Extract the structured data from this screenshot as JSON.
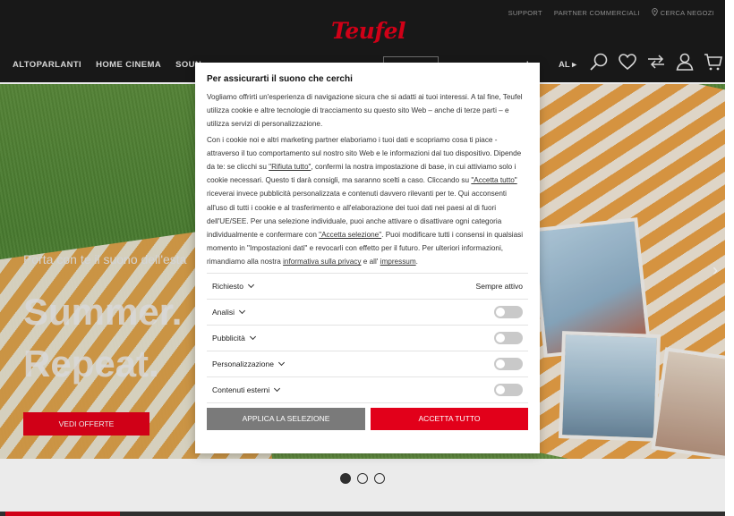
{
  "header": {
    "toplinks": [
      "SUPPORT",
      "PARTNER COMMERCIALI",
      "CERCA NEGOZI"
    ],
    "logo": "Teufel",
    "nav": [
      "ALTOPARLANTI",
      "HOME CINEMA",
      "SOUN"
    ],
    "nav_right_fragment": "I",
    "nav_al": "AL ▸"
  },
  "hero": {
    "subtitle": "Porta con te il suono dell'esta",
    "title_line1": "Summer.",
    "title_line2": "Repeat.",
    "cta": "VEDI OFFERTE",
    "next_arrow": "›"
  },
  "modal": {
    "title": "Per assicurarti il suono che cerchi",
    "p1": "Vogliamo offrirti un'esperienza di navigazione sicura che si adatti ai tuoi interessi. A tal fine, Teufel utilizza cookie e altre tecnologie di tracciamento su questo sito Web – anche di terze parti – e utilizza servizi di personalizzazione.",
    "p2_a": "Con i cookie noi e altri marketing partner elaboriamo i tuoi dati e scopriamo cosa ti piace - attraverso il tuo comportamento sul nostro sito Web e le informazioni dal tuo dispositivo. Dipende da te: se clicchi su ",
    "p2_link1": "\"Rifiuta tutto\"",
    "p2_b": ", confermi la nostra impostazione di base, in cui attiviamo solo i cookie necessari. Questo ti darà consigli, ma saranno scelti a caso. Cliccando su ",
    "p2_link2": "\"Accetta tutto\"",
    "p2_c": " riceverai invece pubblicità personalizzata e contenuti davvero rilevanti per te. Qui acconsenti all'uso di tutti i cookie e al trasferimento e all'elaborazione dei tuoi dati nei paesi al di fuori dell'UE/SEE. Per una selezione individuale, puoi anche attivare o disattivare ogni categoria individualmente e confermare con ",
    "p2_link3": "\"Accetta selezione\"",
    "p2_d": ". Puoi modificare tutti i consensi in qualsiasi momento in \"Impostazioni dati\" e revocarli con effetto per il futuro. Per ulteriori informazioni, rimandiamo alla nostra ",
    "p2_link4": "informativa sulla privacy",
    "p2_e": " e all' ",
    "p2_link5": "impressum",
    "p2_f": ".",
    "categories": [
      {
        "label": "Richiesto",
        "status": "Sempre attivo"
      },
      {
        "label": "Analisi",
        "enabled": false
      },
      {
        "label": "Pubblicità",
        "enabled": false
      },
      {
        "label": "Personalizzazione",
        "enabled": false
      },
      {
        "label": "Contenuti esterni",
        "enabled": false
      }
    ],
    "btn_apply": "APPLICA LA SELEZIONE",
    "btn_accept": "ACCETTA TUTTO"
  },
  "carousel": {
    "active_index": 0,
    "count": 3
  },
  "colors": {
    "brand_red": "#e2001a",
    "header_bg": "#1b1b1b"
  },
  "icons": [
    "location-pin-icon",
    "search-icon",
    "heart-icon",
    "compare-icon",
    "user-icon",
    "cart-icon"
  ]
}
